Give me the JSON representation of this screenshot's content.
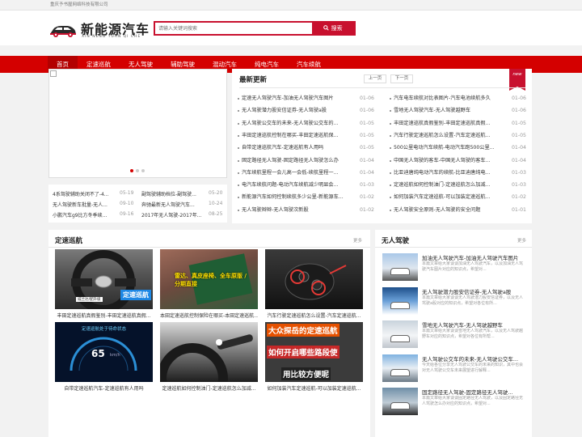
{
  "topbar": {
    "company": "重庆予书屋网络科技有限公司"
  },
  "logo": {
    "title": "新能源汽车",
    "pinyin": "XIN NENG YUAN QI CHE"
  },
  "search": {
    "placeholder": "请输入关键词搜索",
    "button": "搜索"
  },
  "nav": [
    "首页",
    "定速巡航",
    "无人驾驶",
    "辅助驾驶",
    "混动汽车",
    "纯电汽车",
    "汽车续航"
  ],
  "small_news": {
    "left": [
      {
        "title": "4系驾驶辅助关闭不了-4...",
        "date": "05-19"
      },
      {
        "title": "无人驾驶新车批量-无人...",
        "date": "09-10"
      },
      {
        "title": "小鹏汽车g9比方冬季续...",
        "date": "09-16"
      }
    ],
    "right": [
      {
        "title": "副驾驶辅助档位-副驾驶...",
        "date": "05-20"
      },
      {
        "title": "奔驰最新无人驾驶汽车...",
        "date": "10-24"
      },
      {
        "title": "2017年无人驾驶-2017年...",
        "date": "08-25"
      }
    ]
  },
  "latest": {
    "title": "最新更新",
    "prev": "上一页",
    "next": "下一页",
    "badge": "new",
    "left": [
      {
        "title": "定速无人驾驶汽车-加油无人驾驶汽车图片",
        "date": "01-06"
      },
      {
        "title": "无人驾驶潜力股安信证券-无人驾驶a股",
        "date": "01-06"
      },
      {
        "title": "无人驾驶公交车的未来-无人驾驶公交车的...",
        "date": "01-05"
      },
      {
        "title": "丰田定速巡航控制在哪买-丰田定速巡航保...",
        "date": "01-05"
      },
      {
        "title": "自带定速巡航汽车-定速巡航有人用吗",
        "date": "01-05"
      },
      {
        "title": "固定路径无人驾驶-固定路径无人驾驶怎么办",
        "date": "01-04"
      },
      {
        "title": "汽车续航里程一会儿高一会低-续航里程一...",
        "date": "01-04"
      },
      {
        "title": "电汽车续航问题-电动汽车续航减少明显会...",
        "date": "01-03"
      },
      {
        "title": "新能源汽车如何控制续航多少公里-新能源车...",
        "date": "01-02"
      },
      {
        "title": "无人驾驶辫辫-无人驾驶次新股",
        "date": "01-02"
      }
    ],
    "right": [
      {
        "title": "汽车电车续航对比表图片-汽车电池续航多久",
        "date": "01-06"
      },
      {
        "title": "雪地无人驾驶汽车-无人驾驶越野车",
        "date": "01-06"
      },
      {
        "title": "丰田定速巡航真假鉴别-丰田定速巡航真假...",
        "date": "01-05"
      },
      {
        "title": "汽车行驶定速巡航怎么设置-汽车定速巡航...",
        "date": "01-05"
      },
      {
        "title": "500公里电动汽车续航-电动汽车跑500公里...",
        "date": "01-04"
      },
      {
        "title": "中国无人驾驶的客车-中国无人驾驶的客车...",
        "date": "01-04"
      },
      {
        "title": "比亚迪唐纯电动汽车的续航-比亚迪唐纯电...",
        "date": "01-03"
      },
      {
        "title": "定速巡航如何控制油门-定速巡航怎么加减...",
        "date": "01-03"
      },
      {
        "title": "如何加装汽车定速巡航-可以加装定速巡航...",
        "date": "01-02"
      },
      {
        "title": "无人驾驶安全原则-无人驾驶的安全问题",
        "date": "01-01"
      }
    ]
  },
  "cruise": {
    "title": "定速巡航",
    "more": "更多",
    "cards": [
      {
        "caption": "丰田定速巡航真假鉴别-丰田定速巡航真假...",
        "overlay": "定速巡航",
        "sub": "威兰达/配升级"
      },
      {
        "caption": "本田定速巡航控制保险在哪买-本田定速巡航...",
        "overlay": "雷达、真皮座椅、全车原版 / 分期直接"
      },
      {
        "caption": "汽车行驶定速巡航怎么设置-汽车定速巡航...",
        "overlay": ""
      },
      {
        "caption": "自带定速巡航汽车-定速巡航有人用吗",
        "overlay": "定速巡航处于待命状态",
        "speed": "65",
        "unit": "km/h"
      },
      {
        "caption": "定速巡航如何控制油门-定速巡航怎么加减...",
        "overlay": ""
      },
      {
        "caption": "如何加装汽车定速巡航-可以加装定速巡航...",
        "line1": "大众探岳的定速巡航",
        "line2": "如何开启哪些路段使",
        "line3": "用比较方便呢"
      }
    ]
  },
  "driverless": {
    "title": "无人驾驶",
    "more": "更多",
    "items": [
      {
        "title": "加油无人驾驶汽车-加油无人驾驶汽车图片",
        "desc": "本篇文章给大家谈谈加油无人驾驶汽车，以及加油无人驾驶汽车图片对应的知识点，希望对..."
      },
      {
        "title": "无人驾驶潜力股安信证券-无人驾驶a股",
        "desc": "本篇文章给大家谈谈无人驾驶潜力股安信证券，以及无人驾驶a股对应的知识点，希望对各位有所..."
      },
      {
        "title": "雪地无人驾驶汽车-无人驾驶越野车",
        "desc": "本篇文章给大家谈谈雪地无人驾驶汽车，以及无人驾驶越野车对应的知识点，希望对各位有所帮..."
      },
      {
        "title": "无人驾驶公交车的未来-无人驾驶公交车...",
        "desc": "今天给各位分享无人驾驶公交车的未来的知识，其中也会对无人驾驶公交车未来展望进行解释..."
      },
      {
        "title": "固定路径无人驾驶-固定路径无人驾驶...",
        "desc": "本篇文章给大家谈谈固定路径无人驾驶，以及固定路径无人驾驶怎么办对应的知识点，希望对..."
      }
    ]
  }
}
